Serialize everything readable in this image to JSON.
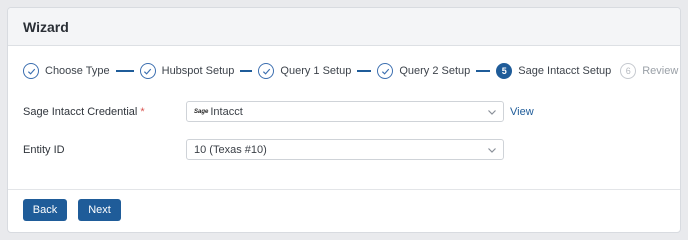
{
  "title": "Wizard",
  "steps": [
    {
      "label": "Choose Type",
      "status": "done"
    },
    {
      "label": "Hubspot Setup",
      "status": "done"
    },
    {
      "label": "Query 1 Setup",
      "status": "done"
    },
    {
      "label": "Query 2 Setup",
      "status": "done"
    },
    {
      "label": "Sage Intacct Setup",
      "status": "active",
      "number": "5"
    },
    {
      "label": "Review",
      "status": "pending",
      "number": "6"
    }
  ],
  "form": {
    "credential": {
      "label": "Sage Intacct Credential",
      "required_mark": "*",
      "logo_text": "Sage",
      "value": "Intacct",
      "link": "View"
    },
    "entity": {
      "label": "Entity ID",
      "value": "10 (Texas #10)"
    }
  },
  "footer": {
    "back_label": "Back",
    "next_label": "Next"
  },
  "colors": {
    "primary": "#1f5c99",
    "required": "#d9534f"
  }
}
